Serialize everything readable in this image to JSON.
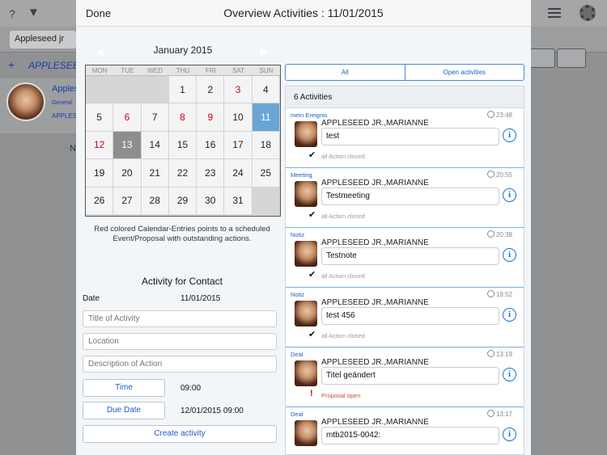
{
  "background": {
    "help_icon": "?",
    "search_field": "Appleseed jr",
    "plus_label": "+",
    "header_text": "APPLESEE",
    "contact_name": "Apples",
    "contact_sub": "General",
    "contact_company": "APPLES",
    "side_text": "N"
  },
  "modal": {
    "done_label": "Done",
    "title": "Overview Activities : 11/01/2015"
  },
  "calendar": {
    "month_label": "January 2015",
    "prev_icon": "◀",
    "next_icon": "▶",
    "weekdays": [
      "MON",
      "TUE",
      "WED",
      "THU",
      "FRI",
      "SAT",
      "SUN"
    ],
    "days": [
      "",
      "",
      "",
      "1",
      "2",
      "3",
      "4",
      "5",
      "6",
      "7",
      "8",
      "9",
      "10",
      "11",
      "12",
      "13",
      "14",
      "15",
      "16",
      "17",
      "18",
      "19",
      "20",
      "21",
      "22",
      "23",
      "24",
      "25",
      "26",
      "27",
      "28",
      "29",
      "30",
      "31",
      ""
    ],
    "red_days": [
      "3",
      "6",
      "8",
      "9",
      "12"
    ],
    "selected_day": "11",
    "today_day": "13",
    "note": "Red colored Calendar-Entries points to a scheduled Event/Proposal with outstanding actions."
  },
  "form": {
    "heading": "Activity for Contact",
    "date_label": "Date",
    "date_value": "11/01/2015",
    "title_placeholder": "Title of Activity",
    "location_placeholder": "Location",
    "description_placeholder": "Description of Action",
    "time_button": "Time",
    "time_value": "09:00",
    "due_button": "Due Date",
    "due_value": "12/01/2015 09:00",
    "create_button": "Create activity"
  },
  "filters": {
    "all_label": "All",
    "open_label": "Open activities"
  },
  "activities": {
    "count_label": "6 Activities",
    "items": [
      {
        "type": "mein Ereignis",
        "time": "23:48",
        "name": "APPLESEED JR.,MARIANNE",
        "title": "test",
        "status": "all Action closed",
        "open": false
      },
      {
        "type": "Meeting",
        "time": "20:55",
        "name": "APPLESEED JR.,MARIANNE",
        "title": "Testmeeting",
        "status": "all Action closed",
        "open": false
      },
      {
        "type": "Notiz",
        "time": "20:38",
        "name": "APPLESEED JR.,MARIANNE",
        "title": "Testnote",
        "status": "all Action closed",
        "open": false
      },
      {
        "type": "Notiz",
        "time": "19:52",
        "name": "APPLESEED JR.,MARIANNE",
        "title": "test 456",
        "status": "all Action closed",
        "open": false
      },
      {
        "type": "Deal",
        "time": "13:19",
        "name": "APPLESEED JR.,MARIANNE",
        "title": "Titel geändert",
        "status": "Proposal open",
        "open": true
      },
      {
        "type": "Deal",
        "time": "13:17",
        "name": "APPLESEED JR.,MARIANNE",
        "title": "mtb2015-0042:",
        "status": "",
        "open": false
      }
    ]
  },
  "icons": {
    "check": "✔",
    "exclaim": "!",
    "info": "i"
  },
  "colors": {
    "accent_blue": "#1a5fc4",
    "selected_day_bg": "#6aa5d6",
    "red_entry": "#d0021b",
    "today_bg": "#8e8e8e"
  }
}
